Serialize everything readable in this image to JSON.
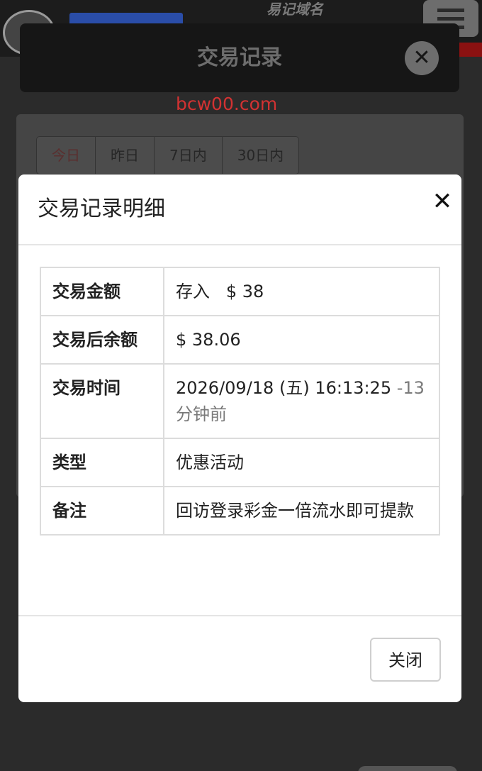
{
  "background": {
    "domain_hint": "易记域名",
    "modal_title": "交易记录",
    "modal_close_icon": "close-circle-icon",
    "filters": [
      "今日",
      "昨日",
      "7日内",
      "30日内"
    ]
  },
  "watermark": "bcw00.com",
  "dialog": {
    "title": "交易记录明细",
    "close_icon": "close-icon",
    "rows": [
      {
        "label": "交易金额",
        "value_prefix": "存入",
        "value": "$ 38"
      },
      {
        "label": "交易后余额",
        "value": "$ 38.06"
      },
      {
        "label": "交易时间",
        "value": "2026/09/18 (五) 16:13:25",
        "value_suffix": "-13分钟前"
      },
      {
        "label": "类型",
        "value": "优惠活动"
      },
      {
        "label": "备注",
        "value": "回访登录彩金一倍流水即可提款"
      }
    ],
    "close_button": "关闭"
  },
  "colors": {
    "deposit_green": "#3f7f3f",
    "watermark_red": "#d23232"
  }
}
